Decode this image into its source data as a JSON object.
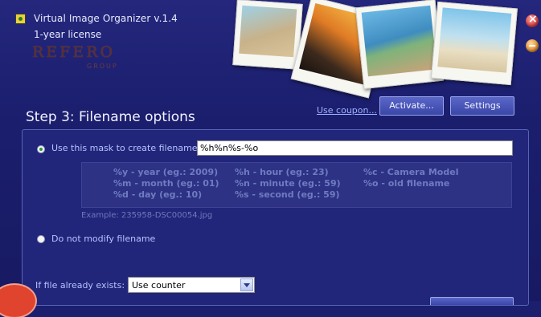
{
  "header": {
    "app_title": "Virtual Image Organizer v.1.4",
    "license": "1-year license",
    "logo_word": "REFERO",
    "logo_sub": "GROUP",
    "icons": {
      "app": "app-icon",
      "close": "close-icon",
      "minimize": "minimize-icon"
    },
    "photos": [
      "beach-photo",
      "sunset-palm-photo",
      "beach-family-photo",
      "beach-chairs-photo"
    ]
  },
  "step": {
    "title": "Step 3: Filename options",
    "coupon_link": "Use coupon...",
    "activate_label": "Activate...",
    "settings_label": "Settings"
  },
  "options": {
    "mask_label": "Use this mask to create filename:",
    "mask_value": "%h%n%s-%o",
    "mask_selected": true,
    "no_modify_label": "Do not modify filename",
    "no_modify_selected": false,
    "hints": {
      "col1": [
        "%y - year (eg.: 2009)",
        "%m - month (eg.: 01)",
        "%d - day (eg.: 10)"
      ],
      "col2": [
        "%h - hour (eg.: 23)",
        "%n - minute (eg.: 59)",
        "%s - second (eg.: 59)"
      ],
      "col3": [
        "%c - Camera Model",
        "%o - old filename"
      ]
    },
    "example": "Example: 235958-DSC00054.jpg",
    "exists_label": "If file already exists:",
    "exists_value": "Use counter"
  },
  "colors": {
    "background": "#1c1f6e",
    "panel": "#22267a",
    "accent_text": "#b6c2ff",
    "hint_text": "#6f7cc0",
    "close_button": "#d23a3a",
    "minimize_button": "#e28a2a"
  }
}
